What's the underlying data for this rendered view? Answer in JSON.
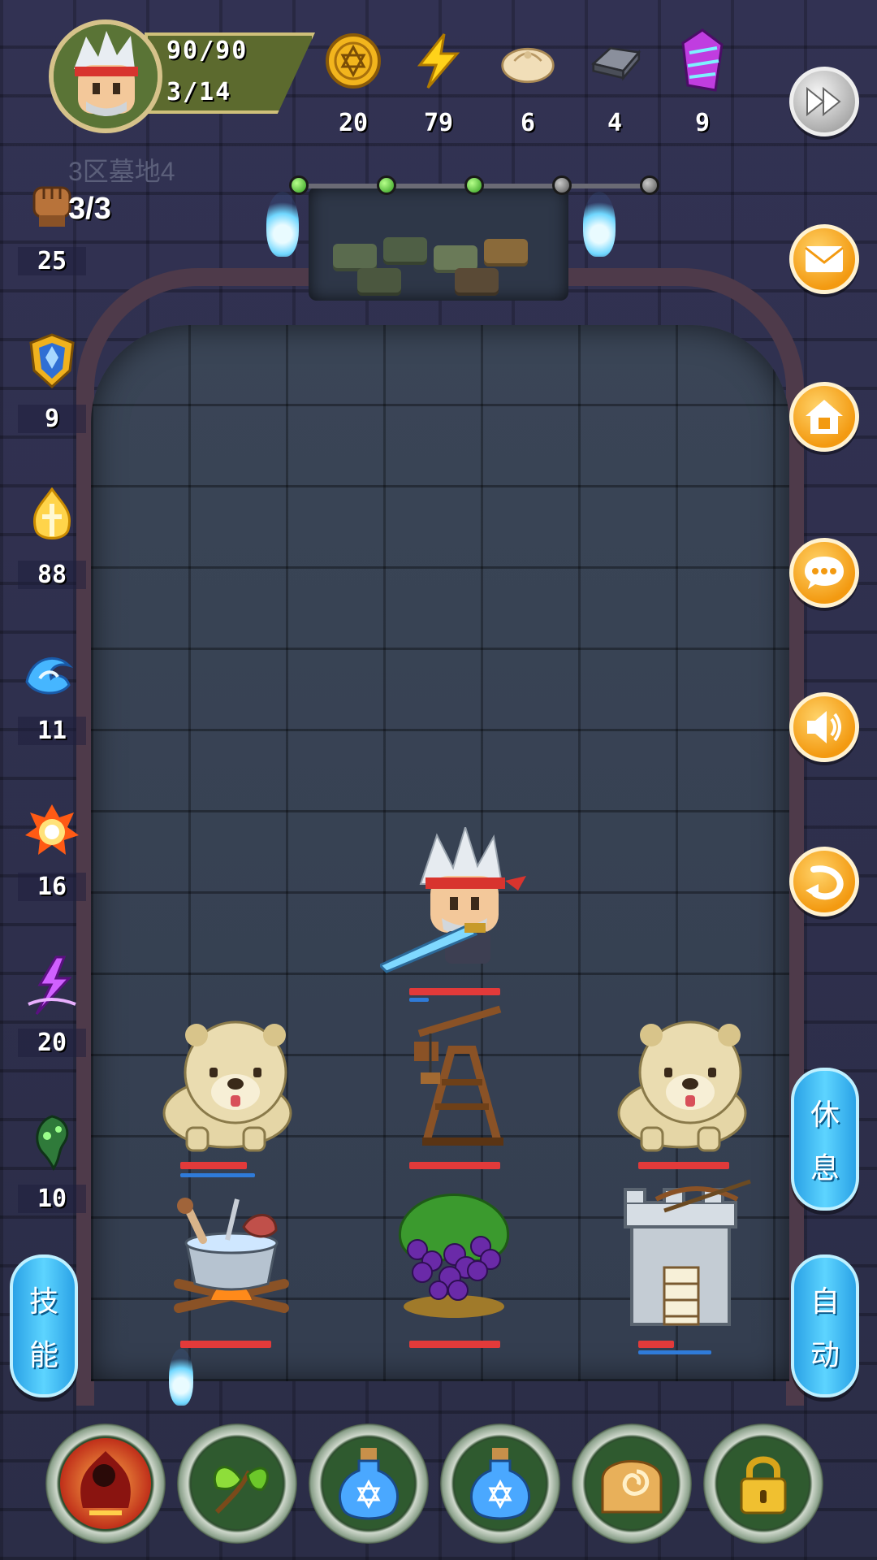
{
  "hud": {
    "hp": "90/90",
    "level": "3/14",
    "zone": "3区墓地4"
  },
  "resources": [
    {
      "name": "coin",
      "icon": "gold-coin-icon",
      "value": "20"
    },
    {
      "name": "energy",
      "icon": "lightning-icon",
      "value": "79"
    },
    {
      "name": "bun",
      "icon": "dumpling-icon",
      "value": "6"
    },
    {
      "name": "iron",
      "icon": "iron-ingot-icon",
      "value": "4"
    },
    {
      "name": "crystal",
      "icon": "crystal-icon",
      "value": "9"
    }
  ],
  "progress": {
    "nodes_total": 5,
    "nodes_done": 3
  },
  "stats": {
    "attacks": "3/3",
    "attack": "25",
    "defense": "9",
    "holy": "88",
    "water": "11",
    "fire": "16",
    "lightning": "20",
    "poison": "10"
  },
  "side_buttons": {
    "rest": [
      "休",
      "息"
    ],
    "auto": [
      "自",
      "动"
    ],
    "skill": [
      "技",
      "能"
    ]
  },
  "units": {
    "hero_hp": 1.0,
    "hero_mp": 0.2,
    "dog_left_hp": 0.75,
    "dog_left_mp": 0.85,
    "catapult_hp": 1.0,
    "dog_right_hp": 1.0,
    "cookpot_hp": 1.0,
    "grapes_hp": 1.0,
    "tower_hp": 0.4,
    "tower_mp": 0.8
  },
  "colors": {
    "accent_orange": "#f39a11",
    "pill_blue": "#2aa2e6",
    "hp_red": "#e23a3a",
    "mp_blue": "#2f7bd9"
  }
}
